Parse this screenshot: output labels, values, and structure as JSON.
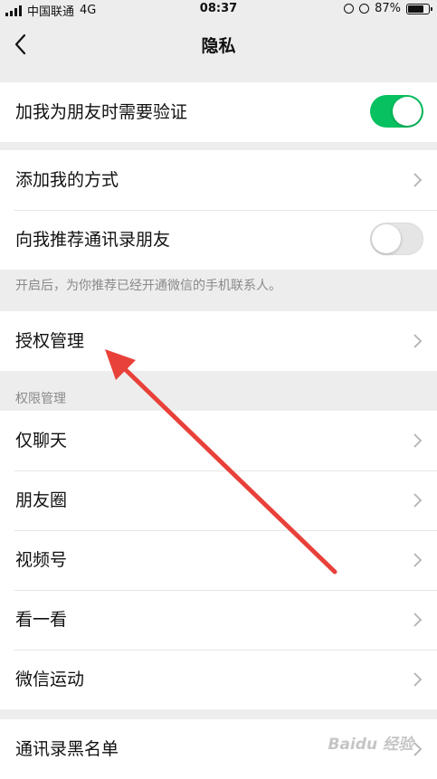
{
  "status_bar": {
    "carrier": "中国联通",
    "network": "4G",
    "time": "08:37",
    "battery_text": "87%",
    "battery_level": 0.87
  },
  "nav": {
    "title": "隐私"
  },
  "groups": {
    "verify": {
      "label": "加我为朋友时需要验证",
      "toggle_on": true
    },
    "add_methods": {
      "label": "添加我的方式"
    },
    "recommend": {
      "label": "向我推荐通讯录朋友",
      "toggle_on": false
    },
    "recommend_hint": "开启后，为你推荐已经开通微信的手机联系人。",
    "auth": {
      "label": "授权管理"
    },
    "permission_section": "权限管理",
    "permission_items": [
      {
        "label": "仅聊天"
      },
      {
        "label": "朋友圈"
      },
      {
        "label": "视频号"
      },
      {
        "label": "看一看"
      },
      {
        "label": "微信运动"
      }
    ],
    "blacklist": {
      "label": "通讯录黑名单"
    }
  },
  "watermark": "Baidu 经验",
  "colors": {
    "toggle_on": "#07c160",
    "arrow": "#e8413a",
    "page_bg": "#ededed"
  }
}
